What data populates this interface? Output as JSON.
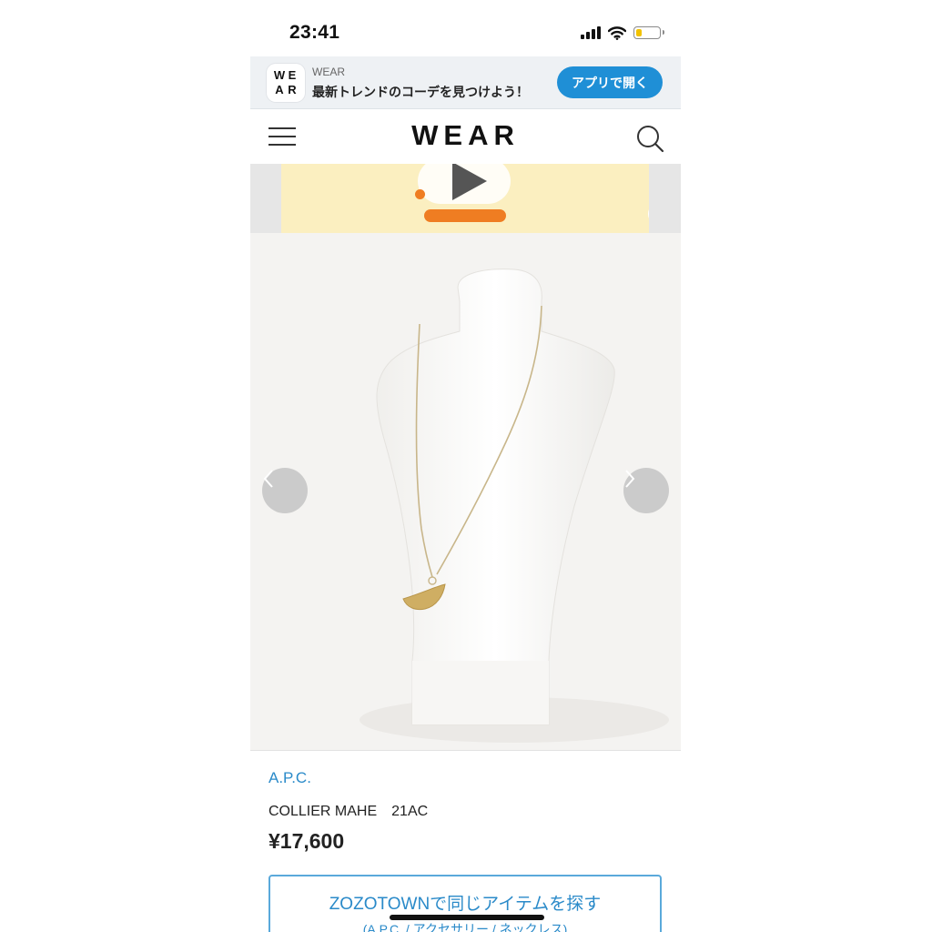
{
  "status_bar": {
    "time": "23:41",
    "battery_level": 0.25,
    "battery_color": "#f2c200"
  },
  "app_banner": {
    "logo_letters": [
      "W",
      "E",
      "A",
      "R"
    ],
    "brand": "WEAR",
    "tagline": "最新トレンドのコーデを見つけよう！",
    "open_app_label": "アプリで開く"
  },
  "header": {
    "logo": "WEAR",
    "menu_icon": "hamburger-menu-icon",
    "search_icon": "search-icon"
  },
  "ad": {
    "play_icon": "play-icon",
    "mute_icon": "speaker-mute-icon",
    "background": "#fbefc0"
  },
  "gallery": {
    "prev_icon": "chevron-left-icon",
    "next_icon": "chevron-right-icon"
  },
  "product": {
    "brand": "A.P.C.",
    "name": "COLLIER MAHE　21AC",
    "price": "¥17,600"
  },
  "zozo": {
    "title": "ZOZOTOWNで同じアイテムを探す",
    "breadcrumb": "(A.P.C. / アクセサリー / ネックレス)"
  },
  "colors": {
    "accent": "#2a8ac9",
    "button": "#1f8fd6"
  }
}
